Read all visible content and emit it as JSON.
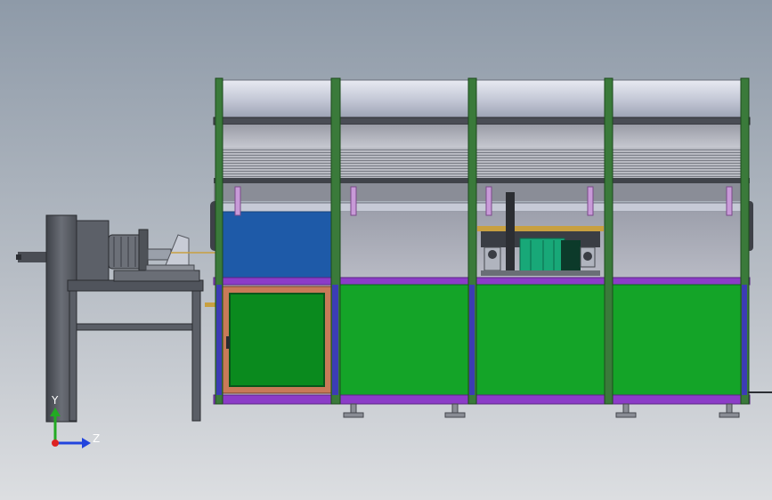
{
  "axes": {
    "y_label": "Y",
    "z_label": "Z",
    "y_color": "#22aa22",
    "z_color": "#2244dd",
    "origin_color": "#dd2222"
  },
  "colors": {
    "background_top": "#8e9aa8",
    "background_bottom": "#dcdee1",
    "frame_green": "#3a7a3a",
    "panel_green": "#14a428",
    "door_green": "#0a8a1e",
    "rail_purple": "#8c3cc8",
    "window_blue": "#1e5aa8",
    "roller_silver": "#c8ccd8",
    "motor_teal": "#18a878",
    "machine_gray": "#5a5e66"
  }
}
